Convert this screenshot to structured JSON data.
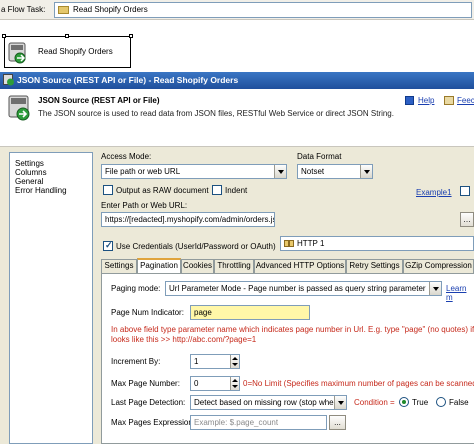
{
  "taskbar": {
    "label": "a Flow Task:",
    "selected_task": "Read Shopify Orders"
  },
  "canvas": {
    "task_name": "Read Shopify Orders"
  },
  "dialog": {
    "title": "JSON Source (REST API or File) - Read Shopify Orders",
    "header_title": "JSON Source (REST API or File)",
    "header_desc": "The JSON source is used to read data from JSON files, RESTful Web Service or direct JSON String.",
    "help_label": "Help",
    "feedback_label": "Feec"
  },
  "nav": {
    "items": [
      "Settings",
      "Columns",
      "General",
      "Error Handling"
    ]
  },
  "settings": {
    "access_mode_label": "Access Mode:",
    "access_mode_value": "File path or web URL",
    "data_format_label": "Data Format",
    "data_format_value": "Notset",
    "output_raw_label": "Output as RAW document",
    "indent_label": "Indent",
    "example_link": "Example1",
    "path_label": "Enter Path or Web URL:",
    "path_value": "https://[redacted].myshopify.com/admin/orders.json",
    "use_credentials_label": "Use Credentials (UserId/Password or OAuth)",
    "connection_value": "HTTP 1"
  },
  "tabs": [
    "Settings",
    "Pagination",
    "Cookies",
    "Throttling",
    "Advanced HTTP Options",
    "Retry Settings",
    "GZip Compression"
  ],
  "pagination": {
    "paging_mode_label": "Paging mode:",
    "paging_mode_value": "Url Parameter Mode - Page number is passed as query string parameter",
    "learn_more": "Learn m",
    "page_num_label": "Page Num Indicator:",
    "page_num_value": "page",
    "hint_line1": "In above field type parameter name which indicates page number in Url. E.g. type \"page\" (no quotes) if URL",
    "hint_line2": "looks like this >> http://abc.com/?page=1",
    "increment_label": "Increment By:",
    "increment_value": "1",
    "max_page_label": "Max Page Number:",
    "max_page_value": "0",
    "max_page_hint": "0=No Limit (Specifies maximum number of pages can be scanned in",
    "last_page_label": "Last Page Detection:",
    "last_page_value": "Detect based on missing row (stop when",
    "condition_label": "Condition =",
    "true_label": "True",
    "false_label": "False",
    "max_pages_expr_label": "Max Pages Expression",
    "max_pages_expr_placeholder": "Example: $.page_count",
    "browse_label": "..."
  }
}
